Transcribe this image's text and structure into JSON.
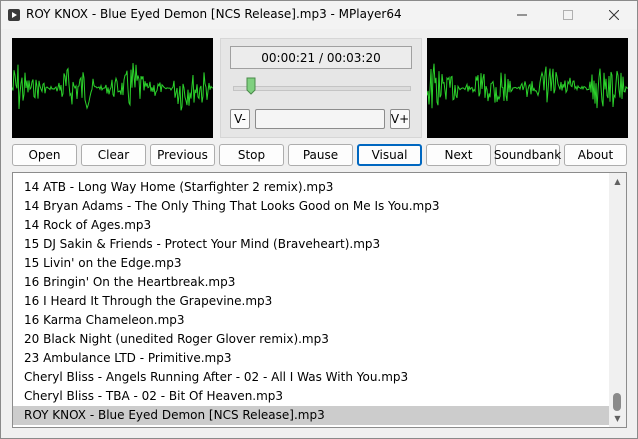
{
  "window": {
    "title": "ROY KNOX - Blue Eyed Demon [NCS Release].mp3 - MPlayer64",
    "icon": "mplayer-app-icon",
    "controls": [
      "minimize-icon",
      "maximize-icon",
      "close-icon"
    ]
  },
  "visualizer": {
    "waveform_color": "#2bd12b",
    "background": "#000000"
  },
  "player": {
    "time_display": "00:00:21 / 00:03:20",
    "seek_progress": 0.105,
    "volume_down_label": "V-",
    "volume_up_label": "V+"
  },
  "toolbar": {
    "buttons": [
      {
        "label": "Open"
      },
      {
        "label": "Clear"
      },
      {
        "label": "Previous"
      },
      {
        "label": "Stop"
      },
      {
        "label": "Pause"
      },
      {
        "label": "Visual",
        "focused": true
      },
      {
        "label": "Next"
      },
      {
        "label": "Soundbank"
      },
      {
        "label": "About"
      }
    ]
  },
  "playlist": {
    "items": [
      "14 ATB - Long Way Home (Starfighter 2 remix).mp3",
      "14 Bryan Adams - The Only Thing That Looks Good on Me Is You.mp3",
      "14 Rock of Ages.mp3",
      "15 DJ Sakin & Friends - Protect Your Mind (Braveheart).mp3",
      "15 Livin' on the Edge.mp3",
      "16 Bringin' On the Heartbreak.mp3",
      "16 I Heard It Through the Grapevine.mp3",
      "16 Karma Chameleon.mp3",
      "20 Black Night (unedited Roger Glover remix).mp3",
      "23 Ambulance LTD - Primitive.mp3",
      "Cheryl Bliss - Angels Running After - 02 - All I Was With You.mp3",
      "Cheryl Bliss - TBA - 02 - Bit Of Heaven.mp3",
      "ROY KNOX - Blue Eyed Demon [NCS Release].mp3"
    ],
    "selected_index": 12
  }
}
